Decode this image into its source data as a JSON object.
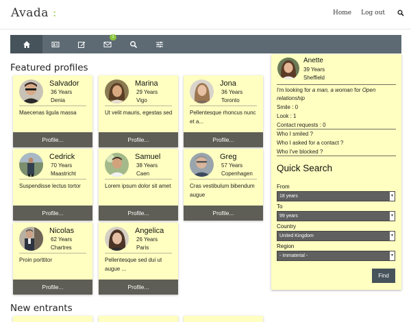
{
  "header": {
    "logo_main": "Avada",
    "logo_accent": " :",
    "nav": {
      "home": "Home",
      "logout": "Log out"
    }
  },
  "toolbar": {
    "items": [
      "home-icon",
      "profile-card-icon",
      "edit-icon",
      "mail-icon",
      "search-icon",
      "sliders-icon"
    ],
    "mail_badge": "1",
    "colors": {
      "bar": "#5d6a73",
      "active": "#46535b",
      "badge": "#8cc63f"
    }
  },
  "featured": {
    "title": "Featured profiles",
    "button_label": "Profile...",
    "profiles": [
      {
        "name": "Salvador",
        "age": "36 Years",
        "city": "Denia",
        "desc": "Maecenas ligula massa"
      },
      {
        "name": "Marina",
        "age": "29 Years",
        "city": "Vigo",
        "desc": "Ut velit mauris, egestas sed"
      },
      {
        "name": "Jona",
        "age": "36 Years",
        "city": "Toronto",
        "desc": "Pellentesque rhoncus nunc et a..."
      },
      {
        "name": "Cedrick",
        "age": "70 Years",
        "city": "Maastricht",
        "desc": "Suspendisse lectus tortor"
      },
      {
        "name": "Samuel",
        "age": "38 Years",
        "city": "Caen",
        "desc": "Lorem ipsum dolor sit amet"
      },
      {
        "name": "Greg",
        "age": "57 Years",
        "city": "Copenhagen",
        "desc": "Cras vestibulum bibendum augue"
      },
      {
        "name": "Nicolas",
        "age": "62 Years",
        "city": "Chartres",
        "desc": "Proin porttitor"
      },
      {
        "name": "Angelica",
        "age": "26 Years",
        "city": "Paris",
        "desc": "Pellentesque sed dui ut augue ..."
      }
    ]
  },
  "new_entrants": {
    "title": "New entrants"
  },
  "sidebar": {
    "user": {
      "name": "Anette",
      "age": "39 Years",
      "city": "Sheffield"
    },
    "looking_prefix": "I'm looking for ",
    "looking_who": "a man, a woman",
    "looking_mid": "  for ",
    "looking_rel": "Open relationship",
    "smile": "Smile : 0",
    "look": "Look : 1",
    "contact_requests": "Contact requests : 0",
    "links": [
      "Who I smiled ?",
      "Who I asked for a contact ?",
      "Who I've blocked ?"
    ]
  },
  "quick_search": {
    "title": "Quick Search",
    "from_label": "From",
    "from_value": "18 years",
    "to_label": " To",
    "to_value": "99 years",
    "country_label": "Country",
    "country_value": "United Kingdom",
    "region_label": "Region",
    "region_value": "- Immaterial -",
    "find_label": "Find"
  }
}
